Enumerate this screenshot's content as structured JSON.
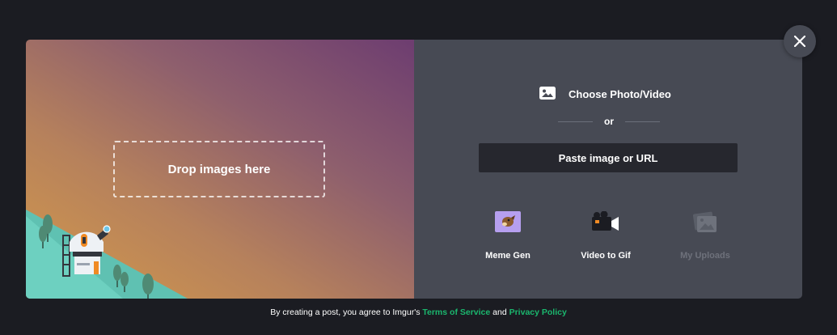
{
  "dropzone": {
    "label": "Drop images here"
  },
  "upload": {
    "choose_label": "Choose Photo/Video",
    "or_label": "or",
    "paste_label": "Paste image or URL"
  },
  "tools": [
    {
      "label": "Meme Gen",
      "icon": "meme-gen-icon",
      "enabled": true
    },
    {
      "label": "Video to Gif",
      "icon": "video-to-gif-icon",
      "enabled": true
    },
    {
      "label": "My Uploads",
      "icon": "my-uploads-icon",
      "enabled": false
    }
  ],
  "footer": {
    "text_before": "By creating a post, you agree to Imgur's ",
    "terms_label": "Terms of Service",
    "text_middle": " and ",
    "privacy_label": "Privacy Policy"
  },
  "colors": {
    "link": "#1bb76e",
    "panel": "#474a54",
    "background": "#1b1c22"
  }
}
